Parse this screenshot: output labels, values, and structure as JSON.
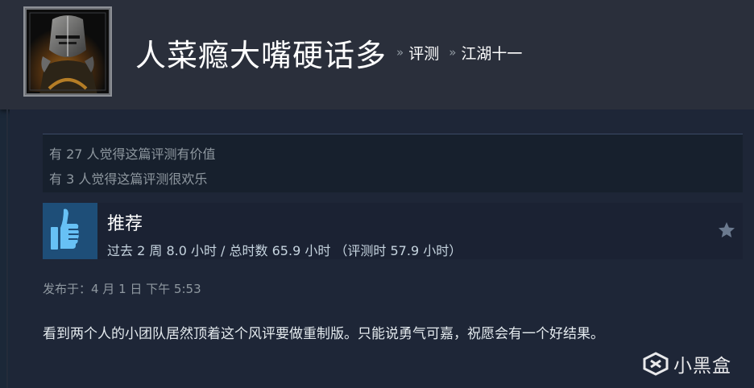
{
  "header": {
    "persona_name": "人菜瘾大嘴硬话多",
    "breadcrumb_sep_1": "»",
    "breadcrumb_reviews": "评测",
    "breadcrumb_sep_2": "»",
    "breadcrumb_game": "江湖十一"
  },
  "helpful": {
    "line1": "有 27 人觉得这篇评测有价值",
    "line2": "有 3 人觉得这篇评测很欢乐"
  },
  "review": {
    "thumb_icon": "thumbs-up-icon",
    "recommendation": "推荐",
    "hours": "过去 2 周 8.0 小时 / 总时数 65.9 小时 （评测时 57.9 小时）",
    "star_icon": "star-icon",
    "posted": "发布于：4 月 1 日 下午 5:53",
    "text": "看到两个人的小团队居然顶着这个风评要做重制版。只能说勇气可嘉，祝愿会有一个好结果。"
  },
  "watermark": {
    "icon": "xiaoheihe-logo-icon",
    "label": "小黑盒"
  },
  "colors": {
    "page_bg": "#1b2838",
    "header_bg": "#2a2f3b",
    "thumb_bg": "#1e4e78",
    "thumb_fg": "#67c1f5",
    "muted_text": "#8f98a0"
  }
}
